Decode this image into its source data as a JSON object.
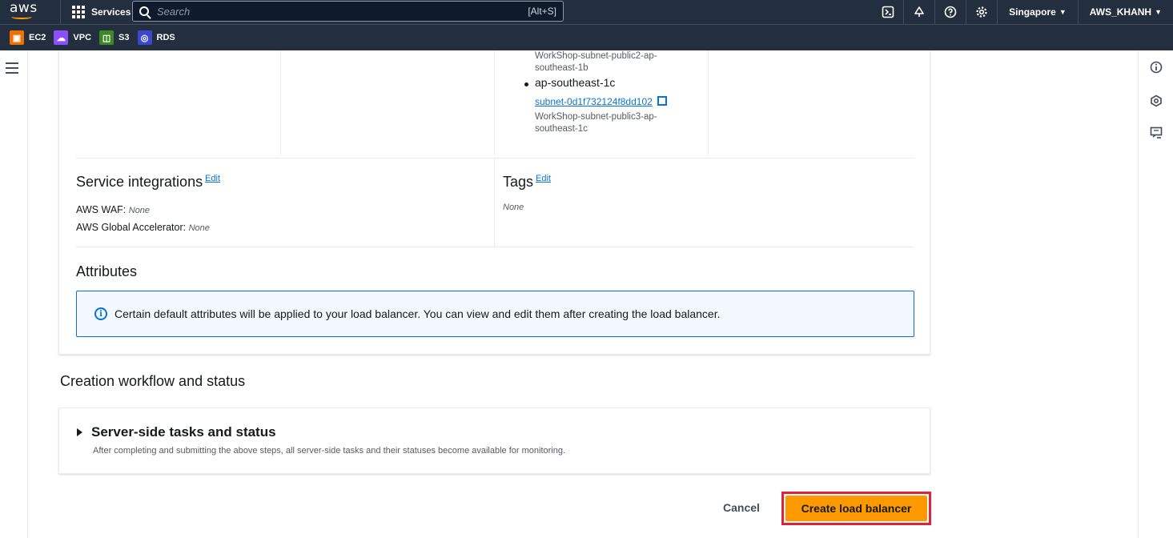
{
  "topnav": {
    "logo_text": "aws",
    "services_label": "Services",
    "search_placeholder": "Search",
    "search_shortcut": "[Alt+S]",
    "region": "Singapore",
    "account": "AWS_KHANH",
    "icons": [
      "cloudshell-icon",
      "bell-icon",
      "help-icon",
      "settings-icon"
    ]
  },
  "favorites": [
    {
      "label": "EC2",
      "color": "#ed7100",
      "icon": "ec2-icon"
    },
    {
      "label": "VPC",
      "color": "#8c4fff",
      "icon": "vpc-icon"
    },
    {
      "label": "S3",
      "color": "#3f8624",
      "icon": "s3-icon"
    },
    {
      "label": "RDS",
      "color": "#3b48cc",
      "icon": "rds-icon"
    }
  ],
  "network": {
    "prev_subnet_name": "WorkShop-subnet-public2-ap-southeast-1b",
    "prev_subnet_line1": "WorkShop-subnet-public2-ap-",
    "prev_subnet_line2": "southeast-1b",
    "az3": "ap-southeast-1c",
    "az3_subnet_id": "subnet-0d1f732124f8dd102",
    "az3_subnet_line1": "WorkShop-subnet-public3-ap-",
    "az3_subnet_line2": "southeast-1c"
  },
  "service_integrations": {
    "title": "Service integrations",
    "edit": "Edit",
    "waf_label": "AWS WAF:",
    "waf_value": "None",
    "ga_label": "AWS Global Accelerator:",
    "ga_value": "None"
  },
  "tags": {
    "title": "Tags",
    "edit": "Edit",
    "value": "None"
  },
  "attributes": {
    "title": "Attributes",
    "info": "Certain default attributes will be applied to your load balancer. You can view and edit them after creating the load balancer."
  },
  "workflow": {
    "title": "Creation workflow and status",
    "server_side_title": "Server-side tasks and status",
    "server_side_desc": "After completing and submitting the above steps, all server-side tasks and their statuses become available for monitoring."
  },
  "actions": {
    "cancel": "Cancel",
    "create": "Create load balancer"
  },
  "colors": {
    "nav_bg": "#232f3e",
    "link": "#0972d3",
    "primary": "#ff9900",
    "highlight": "#e2223b"
  }
}
